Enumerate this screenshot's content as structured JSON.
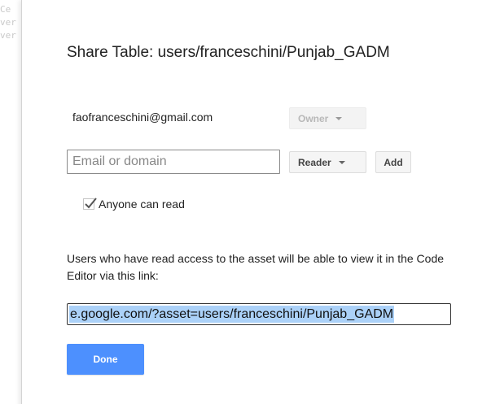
{
  "background": {
    "code_fragments": [
      "Ce",
      "ver",
      "ver"
    ]
  },
  "dialog": {
    "title": "Share Table: users/franceschini/Punjab_GADM",
    "owner": {
      "email": "faofranceschini@gmail.com",
      "role": "Owner"
    },
    "add_user": {
      "input_placeholder": "Email or domain",
      "input_value": "",
      "role": "Reader",
      "add_label": "Add"
    },
    "anyone_can_read": {
      "label": "Anyone can read",
      "checked": true
    },
    "info_text": "Users who have read access to the asset will be able to view it in the Code Editor via this link:",
    "link_value": "e.google.com/?asset=users/franceschini/Punjab_GADM",
    "done_label": "Done"
  },
  "colors": {
    "primary_button": "#4d90fe",
    "text_selection": "#abd1f8",
    "disabled_text": "#b8b8b8"
  }
}
